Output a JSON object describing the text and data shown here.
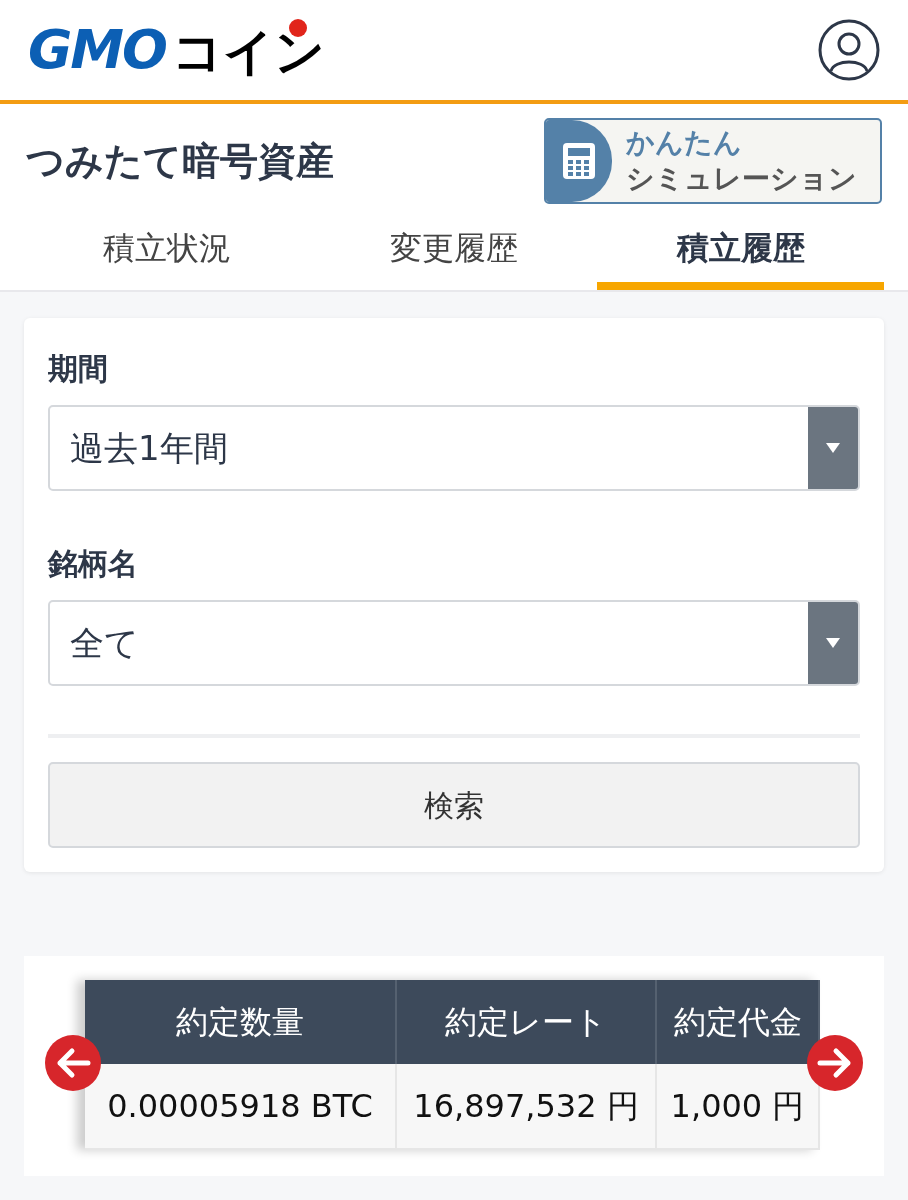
{
  "header": {
    "logo": {
      "latin": "GMO",
      "kana": "コイン"
    }
  },
  "page_title": "つみたて暗号資産",
  "simulation_button": {
    "line1": "かんたん",
    "line2": "シミュレーション"
  },
  "tabs": [
    {
      "label": "積立状況",
      "selected": false
    },
    {
      "label": "変更履歴",
      "selected": false
    },
    {
      "label": "積立履歴",
      "selected": true
    }
  ],
  "filters": [
    {
      "label": "期間",
      "value": "過去1年間"
    },
    {
      "label": "銘柄名",
      "value": "全て"
    }
  ],
  "search_button": "検索",
  "table": {
    "columns": [
      "約定数量",
      "約定レート",
      "約定代金"
    ],
    "rows": [
      [
        "0.00005918 BTC",
        "16,897,532 円",
        "1,000 円"
      ]
    ]
  }
}
